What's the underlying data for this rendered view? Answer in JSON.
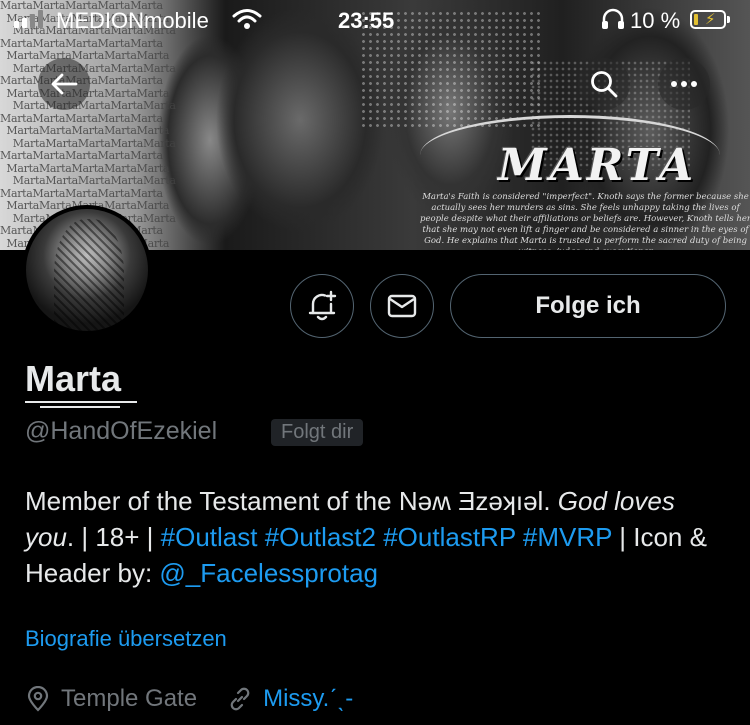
{
  "status_bar": {
    "carrier": "MEDIONmobile",
    "time": "23:55",
    "battery_percent": "10 %",
    "signal_bars_active": 2,
    "signal_bars_total": 4
  },
  "header": {
    "logo_text": "MARTA",
    "caption": "Marta's Faith is considered \"imperfect\". Knoth says the former because she actually sees her murders as sins. She feels unhappy taking the lives of people despite what their affiliations or beliefs are. However, Knoth tells her that she may not even lift a finger and be considered a sinner in the eyes of God. He explains that Marta is trusted to perform the sacred duty of being witness, judge and executioner",
    "tile_word": "Marta"
  },
  "actions": {
    "follow_label": "Folge ich"
  },
  "profile": {
    "name": "Marta",
    "handle": "@HandOfEzekiel",
    "follows_you": "Folgt dir",
    "bio": {
      "part1": "Member of the Testament of the Nəʍ Ǝzəʞıəl. ",
      "italic": "God loves you",
      "part2": ". | 18+ | ",
      "tags": "#Outlast #Outlast2 #OutlastRP #MVRP",
      "part3": " | Icon & Header by: ",
      "mention": "@_Facelessprotag"
    },
    "translate_label": "Biografie übersetzen",
    "location": "Temple Gate",
    "website": "Missy.ˊˎ-"
  },
  "colors": {
    "accent": "#1d9bf0",
    "secondary_text": "#71767b",
    "battery_low": "#e3c133"
  },
  "icons": [
    "back-arrow-icon",
    "search-icon",
    "more-icon",
    "notification-bell-plus-icon",
    "mail-icon",
    "location-pin-icon",
    "link-icon",
    "wifi-icon",
    "headphones-icon"
  ]
}
